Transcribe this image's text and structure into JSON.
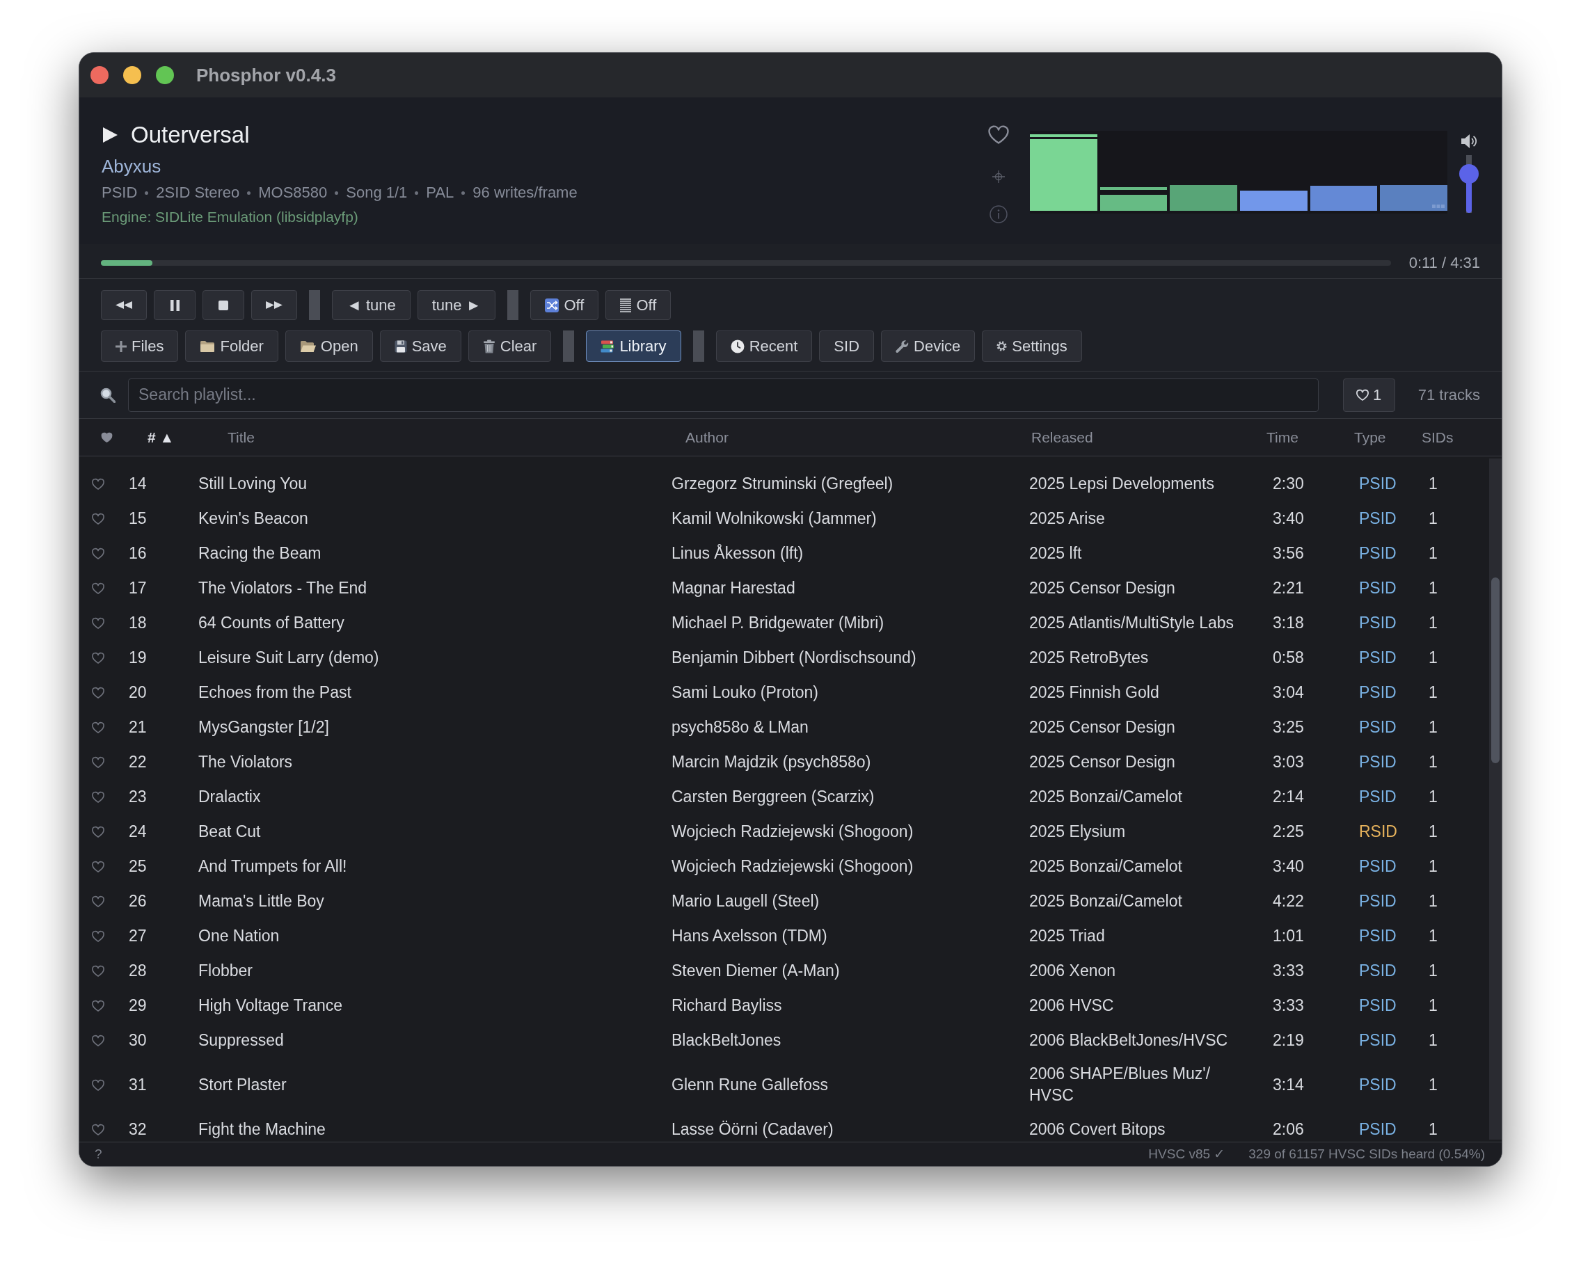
{
  "window": {
    "title": "Phosphor v0.4.3"
  },
  "now_playing": {
    "title": "Outerversal",
    "author": "Abyxus",
    "details": [
      "PSID",
      "2SID Stereo",
      "MOS8580",
      "Song 1/1",
      "PAL",
      "96 writes/frame"
    ],
    "engine": "Engine: SIDLite Emulation (libsidplayfp)",
    "favorite": false
  },
  "volume": {
    "level": 0.67
  },
  "progress": {
    "level": 0.04,
    "time": "0:11 / 4:31"
  },
  "transport": [
    {
      "kind": "rewind"
    },
    {
      "kind": "pause"
    },
    {
      "kind": "stop"
    },
    {
      "kind": "forward"
    },
    {
      "kind": "separator"
    },
    {
      "kind": "tune",
      "label": "◄ tune"
    },
    {
      "kind": "tune",
      "label": "tune ►"
    },
    {
      "kind": "separator"
    },
    {
      "kind": "shuffle",
      "label": "Off"
    },
    {
      "kind": "lines",
      "label": "Off"
    }
  ],
  "toolbar": [
    {
      "kind": "plus",
      "label": "Files",
      "selected": false
    },
    {
      "kind": "folder",
      "label": "Folder",
      "selected": false
    },
    {
      "kind": "openfolder",
      "label": "Open",
      "selected": false
    },
    {
      "kind": "disk",
      "label": "Save",
      "selected": false
    },
    {
      "kind": "trash",
      "label": "Clear",
      "selected": false
    },
    {
      "kind": "separator"
    },
    {
      "kind": "books",
      "label": "Library",
      "selected": true
    },
    {
      "kind": "separator"
    },
    {
      "kind": "clock",
      "label": "Recent",
      "selected": false
    },
    {
      "kind": "plain",
      "label": "SID",
      "selected": false
    },
    {
      "kind": "wrench",
      "label": "Device",
      "selected": false
    },
    {
      "kind": "gear",
      "label": "Settings",
      "selected": false
    }
  ],
  "search": {
    "placeholder": "Search playlist..."
  },
  "favorites_filter": {
    "label": "1"
  },
  "track_count": "71 tracks",
  "table": {
    "columns": [
      {
        "kind": "heart",
        "sorted": false
      },
      {
        "kind": "text",
        "label": "# ▲",
        "sorted": true
      },
      {
        "kind": "text",
        "label": "Title",
        "sorted": false
      },
      {
        "kind": "text",
        "label": "Author",
        "sorted": false
      },
      {
        "kind": "text",
        "label": "Released",
        "sorted": false
      },
      {
        "kind": "text",
        "label": "Time",
        "sorted": false
      },
      {
        "kind": "text",
        "label": "Type",
        "sorted": false
      },
      {
        "kind": "text",
        "label": "SIDs",
        "sorted": false
      }
    ],
    "rows": [
      {
        "favorite": false,
        "number": "14",
        "title": "Still Loving You",
        "author": "Grzegorz Struminski (Gregfeel)",
        "released": "2025 Lepsi Developments",
        "time": "2:30",
        "type": {
          "label": "PSID",
          "color": "#7ab2e4"
        },
        "sids": "1"
      },
      {
        "favorite": false,
        "number": "15",
        "title": "Kevin's Beacon",
        "author": "Kamil Wolnikowski (Jammer)",
        "released": "2025 Arise",
        "time": "3:40",
        "type": {
          "label": "PSID",
          "color": "#7ab2e4"
        },
        "sids": "1"
      },
      {
        "favorite": false,
        "number": "16",
        "title": "Racing the Beam",
        "author": "Linus Åkesson (lft)",
        "released": "2025 lft",
        "time": "3:56",
        "type": {
          "label": "PSID",
          "color": "#7ab2e4"
        },
        "sids": "1"
      },
      {
        "favorite": false,
        "number": "17",
        "title": "The Violators - The End",
        "author": "Magnar Harestad",
        "released": "2025 Censor Design",
        "time": "2:21",
        "type": {
          "label": "PSID",
          "color": "#7ab2e4"
        },
        "sids": "1"
      },
      {
        "favorite": false,
        "number": "18",
        "title": "64 Counts of Battery",
        "author": "Michael P. Bridgewater (Mibri)",
        "released": "2025 Atlantis/MultiStyle Labs",
        "time": "3:18",
        "type": {
          "label": "PSID",
          "color": "#7ab2e4"
        },
        "sids": "1"
      },
      {
        "favorite": false,
        "number": "19",
        "title": "Leisure Suit Larry (demo)",
        "author": "Benjamin Dibbert (Nordischsound)",
        "released": "2025 RetroBytes",
        "time": "0:58",
        "type": {
          "label": "PSID",
          "color": "#7ab2e4"
        },
        "sids": "1"
      },
      {
        "favorite": false,
        "number": "20",
        "title": "Echoes from the Past",
        "author": "Sami Louko (Proton)",
        "released": "2025 Finnish Gold",
        "time": "3:04",
        "type": {
          "label": "PSID",
          "color": "#7ab2e4"
        },
        "sids": "1"
      },
      {
        "favorite": false,
        "number": "21",
        "title": "MysGangster [1/2]",
        "author": "psych858o & LMan",
        "released": "2025 Censor Design",
        "time": "3:25",
        "type": {
          "label": "PSID",
          "color": "#7ab2e4"
        },
        "sids": "1"
      },
      {
        "favorite": false,
        "number": "22",
        "title": "The Violators",
        "author": "Marcin Majdzik (psych858o)",
        "released": "2025 Censor Design",
        "time": "3:03",
        "type": {
          "label": "PSID",
          "color": "#7ab2e4"
        },
        "sids": "1"
      },
      {
        "favorite": false,
        "number": "23",
        "title": "Dralactix",
        "author": "Carsten Berggreen (Scarzix)",
        "released": "2025 Bonzai/Camelot",
        "time": "2:14",
        "type": {
          "label": "PSID",
          "color": "#7ab2e4"
        },
        "sids": "1"
      },
      {
        "favorite": false,
        "number": "24",
        "title": "Beat Cut",
        "author": "Wojciech Radziejewski (Shogoon)",
        "released": "2025 Elysium",
        "time": "2:25",
        "type": {
          "label": "RSID",
          "color": "#e6b25c"
        },
        "sids": "1"
      },
      {
        "favorite": false,
        "number": "25",
        "title": "And Trumpets for All!",
        "author": "Wojciech Radziejewski (Shogoon)",
        "released": "2025 Bonzai/Camelot",
        "time": "3:40",
        "type": {
          "label": "PSID",
          "color": "#7ab2e4"
        },
        "sids": "1"
      },
      {
        "favorite": false,
        "number": "26",
        "title": "Mama's Little Boy",
        "author": "Mario Laugell (Steel)",
        "released": "2025 Bonzai/Camelot",
        "time": "4:22",
        "type": {
          "label": "PSID",
          "color": "#7ab2e4"
        },
        "sids": "1"
      },
      {
        "favorite": false,
        "number": "27",
        "title": "One Nation",
        "author": "Hans Axelsson (TDM)",
        "released": "2025 Triad",
        "time": "1:01",
        "type": {
          "label": "PSID",
          "color": "#7ab2e4"
        },
        "sids": "1"
      },
      {
        "favorite": false,
        "number": "28",
        "title": "Flobber",
        "author": "Steven Diemer (A-Man)",
        "released": "2006 Xenon",
        "time": "3:33",
        "type": {
          "label": "PSID",
          "color": "#7ab2e4"
        },
        "sids": "1"
      },
      {
        "favorite": false,
        "number": "29",
        "title": "High Voltage Trance",
        "author": "Richard Bayliss",
        "released": "2006 HVSC",
        "time": "3:33",
        "type": {
          "label": "PSID",
          "color": "#7ab2e4"
        },
        "sids": "1"
      },
      {
        "favorite": false,
        "number": "30",
        "title": "Suppressed",
        "author": "BlackBeltJones",
        "released": "2006 BlackBeltJones/HVSC",
        "time": "2:19",
        "type": {
          "label": "PSID",
          "color": "#7ab2e4"
        },
        "sids": "1"
      },
      {
        "favorite": false,
        "number": "31",
        "title": "Stort Plaster",
        "author": "Glenn Rune Gallefoss",
        "released": "2006 SHAPE/Blues Muz'/ HVSC",
        "time": "3:14",
        "type": {
          "label": "PSID",
          "color": "#7ab2e4"
        },
        "sids": "1"
      },
      {
        "favorite": false,
        "number": "32",
        "title": "Fight the Machine",
        "author": "Lasse Öörni (Cadaver)",
        "released": "2006 Covert Bitops",
        "time": "2:06",
        "type": {
          "label": "PSID",
          "color": "#7ab2e4"
        },
        "sids": "1"
      }
    ]
  },
  "status_bar": {
    "help": "?",
    "hvsc": "HVSC v85 ✓",
    "heard": "329 of 61157 HVSC SIDs heard (0.54%)"
  }
}
